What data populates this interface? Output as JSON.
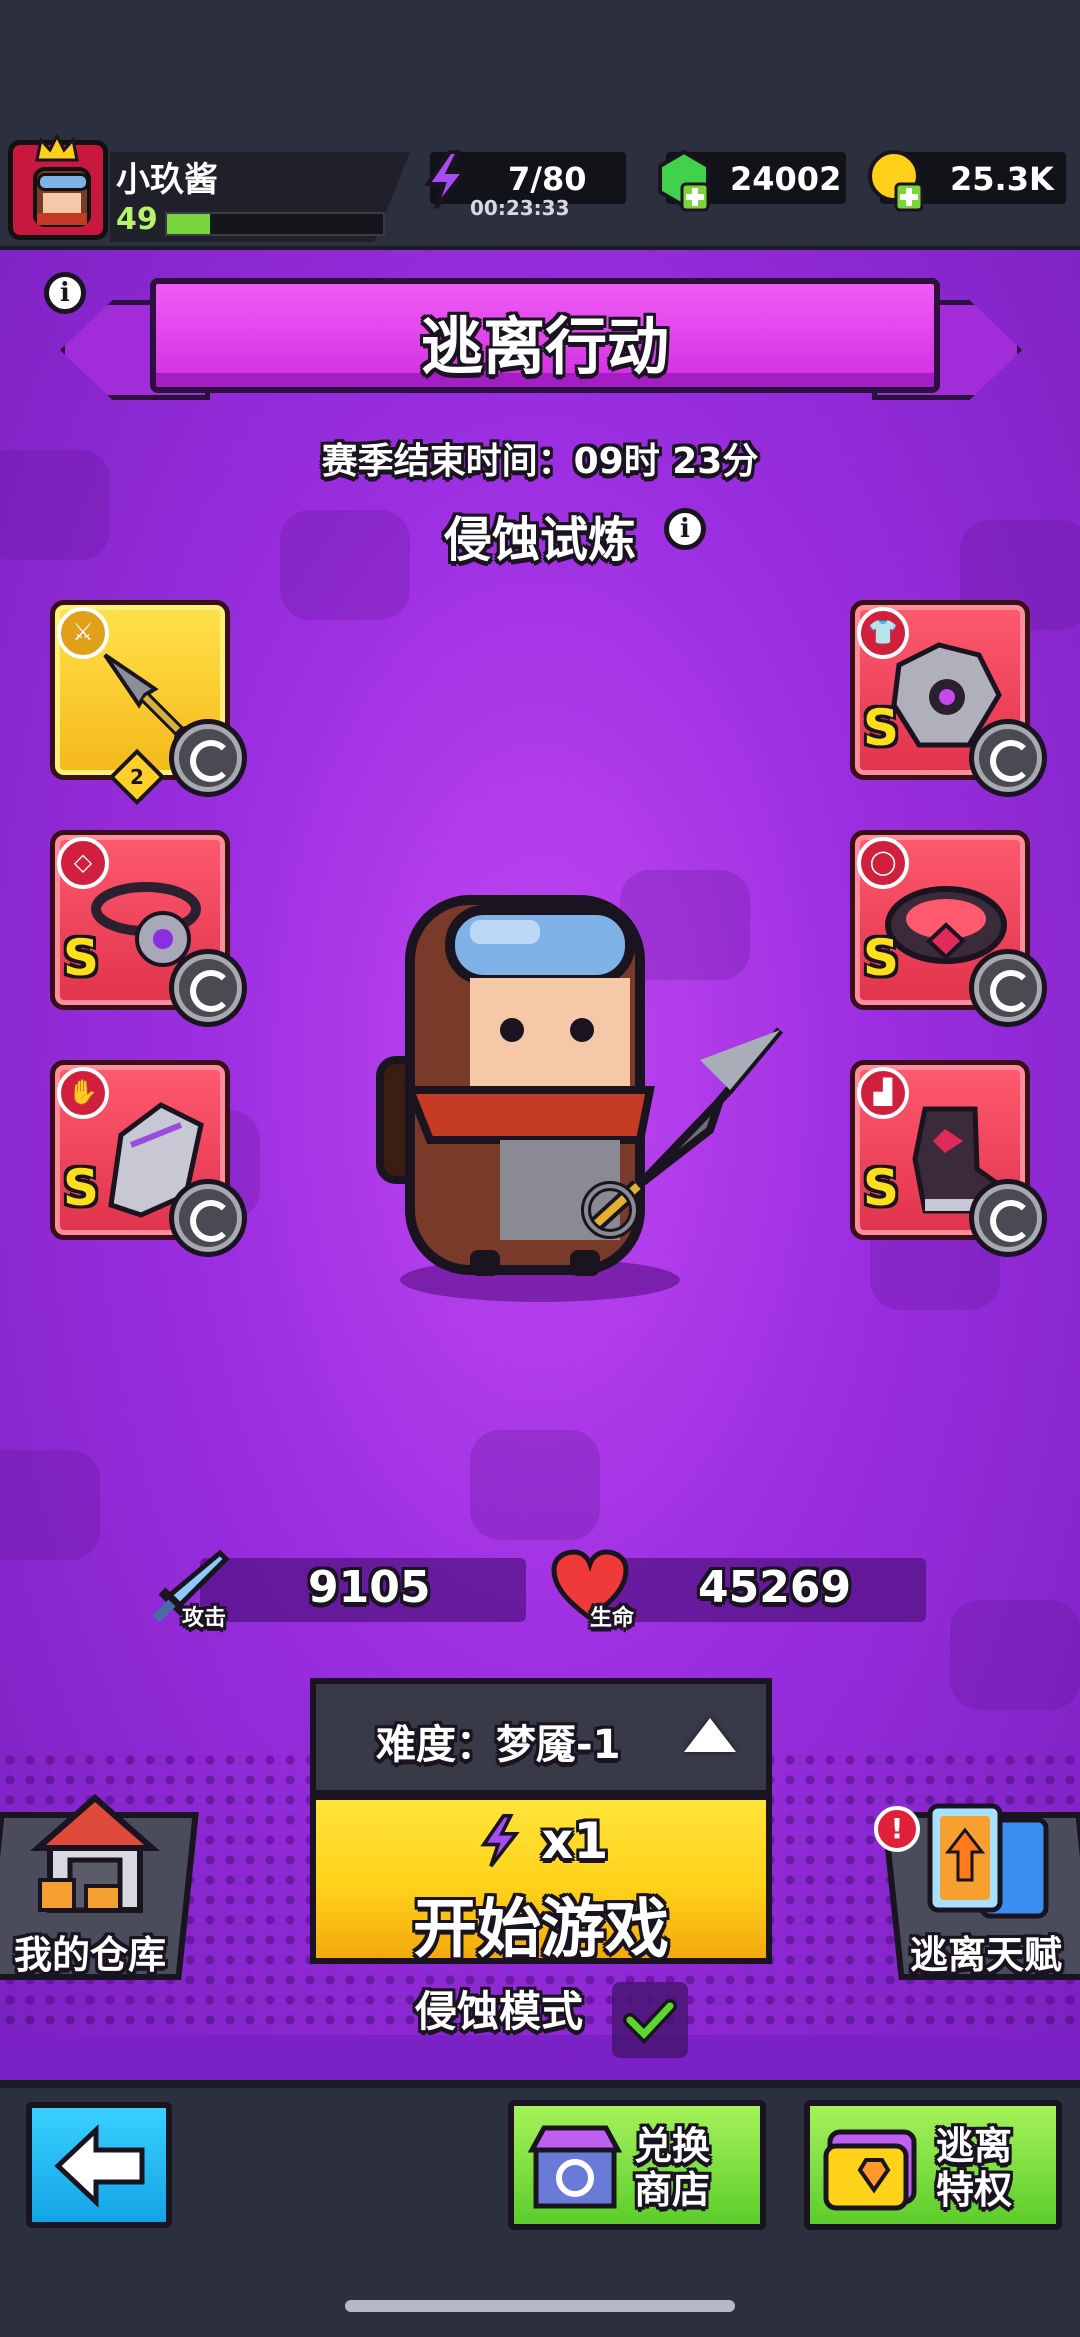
{
  "player": {
    "name": "小玖酱",
    "level": "49",
    "xp_fraction": 0.2
  },
  "resources": {
    "energy": "7/80",
    "energy_timer": "00:23:33",
    "gems": "24002",
    "gold": "25.3K"
  },
  "banner": {
    "title": "逃离行动"
  },
  "season": {
    "label": "赛季结束时间：09时 23分"
  },
  "trial": {
    "title": "侵蚀试炼"
  },
  "equipment": {
    "weapon_level": "2",
    "grade": "S"
  },
  "stats": {
    "attack_label": "攻击",
    "attack_value": "9105",
    "hp_label": "生命",
    "hp_value": "45269"
  },
  "difficulty": {
    "label": "难度：梦魇-1"
  },
  "start": {
    "cost": "x1",
    "label": "开始游戏"
  },
  "side": {
    "warehouse": "我的仓库",
    "talent": "逃离天赋",
    "alert": "!"
  },
  "mode": {
    "label": "侵蚀模式"
  },
  "footer": {
    "shop": "兑换\n商店",
    "privilege": "逃离\n特权"
  },
  "colors": {
    "banner": "#e43fea",
    "start": "#ffd21a",
    "slot": "#ff5a6e",
    "footer_green": "#7ad43b"
  }
}
